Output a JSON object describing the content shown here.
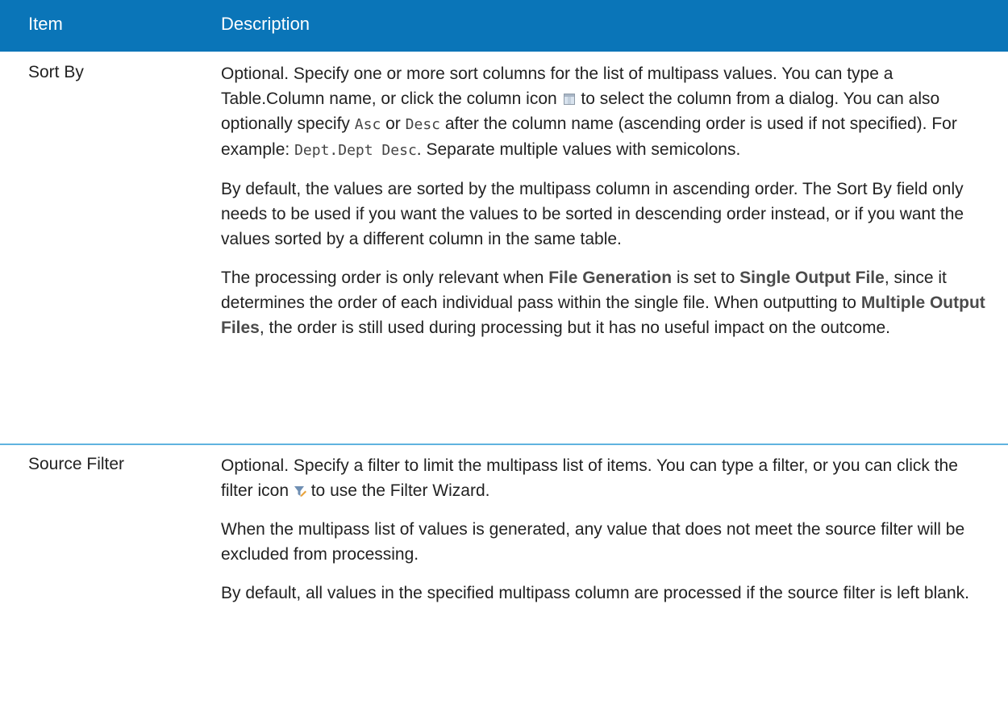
{
  "table": {
    "header": {
      "item": "Item",
      "description": "Description"
    },
    "rows": [
      {
        "item": "Sort By",
        "p1": {
          "t1": "Optional. Specify one or more sort columns for the list of multipass values. You can type a Table.Column name, or click the column icon",
          "t2": "to select the column from a dialog. You can also optionally specify",
          "code_asc": "Asc",
          "t3": "or",
          "code_desc": "Desc",
          "t4": "after the column name (ascending order is used if not specified). For example:",
          "code_example": "Dept.Dept Desc",
          "t5": ". Separate multiple values with semicolons."
        },
        "p2": "By default, the values are sorted by the multipass column in ascending order. The Sort By field only needs to be used if you want the values to be sorted in descending order instead, or if you want the values sorted by a different column in the same table.",
        "p3": {
          "t1": "The processing order is only relevant when",
          "b1": "File Generation",
          "t2": "is set to",
          "b2": "Single Output File",
          "t3": ", since it determines the order of each individual pass within the single file. When outputting to",
          "b3": "Multiple Output Files",
          "t4": ", the order is still used during processing but it has no useful impact on the outcome."
        }
      },
      {
        "item": "Source Filter",
        "p1": {
          "t1": "Optional. Specify a filter to limit the multipass list of items. You can type a filter, or you can click the filter icon",
          "t2": "to use the Filter Wizard."
        },
        "p2": "When the multipass list of values is generated, any value that does not meet the source filter will be excluded from processing.",
        "p3": "By default, all values in the specified multipass column are processed if the source filter is left blank."
      }
    ]
  },
  "icons": {
    "column": "table-column-icon",
    "filter": "filter-edit-icon"
  },
  "colors": {
    "header_bg": "#0a75b8",
    "row_separator": "#5fb3df"
  }
}
